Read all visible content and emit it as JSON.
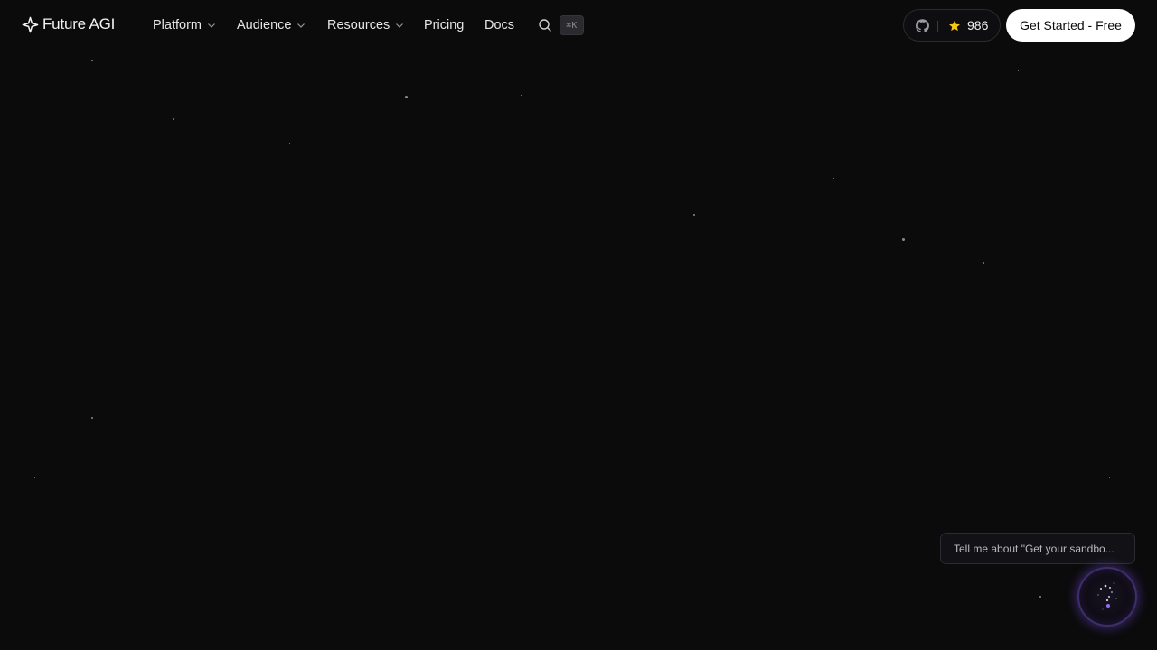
{
  "brand": {
    "name": "Future AGI",
    "icon": "sparkle-logo-icon"
  },
  "nav": {
    "items": [
      {
        "label": "Platform",
        "has_dropdown": true
      },
      {
        "label": "Audience",
        "has_dropdown": true
      },
      {
        "label": "Resources",
        "has_dropdown": true
      },
      {
        "label": "Pricing",
        "has_dropdown": false
      },
      {
        "label": "Docs",
        "has_dropdown": false
      }
    ],
    "search_icon": "search-icon",
    "shortcut": "⌘K"
  },
  "github": {
    "icon": "github-icon",
    "star_icon": "star-icon",
    "stars": "986"
  },
  "cta": {
    "label": "Get Started - Free"
  },
  "chat": {
    "suggestion": "Tell me about \"Get your sandbo...",
    "launcher_icon": "assistant-orb-icon"
  },
  "colors": {
    "background": "#0b0b0c",
    "cta_bg": "#ffffff",
    "star_yellow": "#f5c518",
    "orb_accent": "#6e46c8"
  }
}
